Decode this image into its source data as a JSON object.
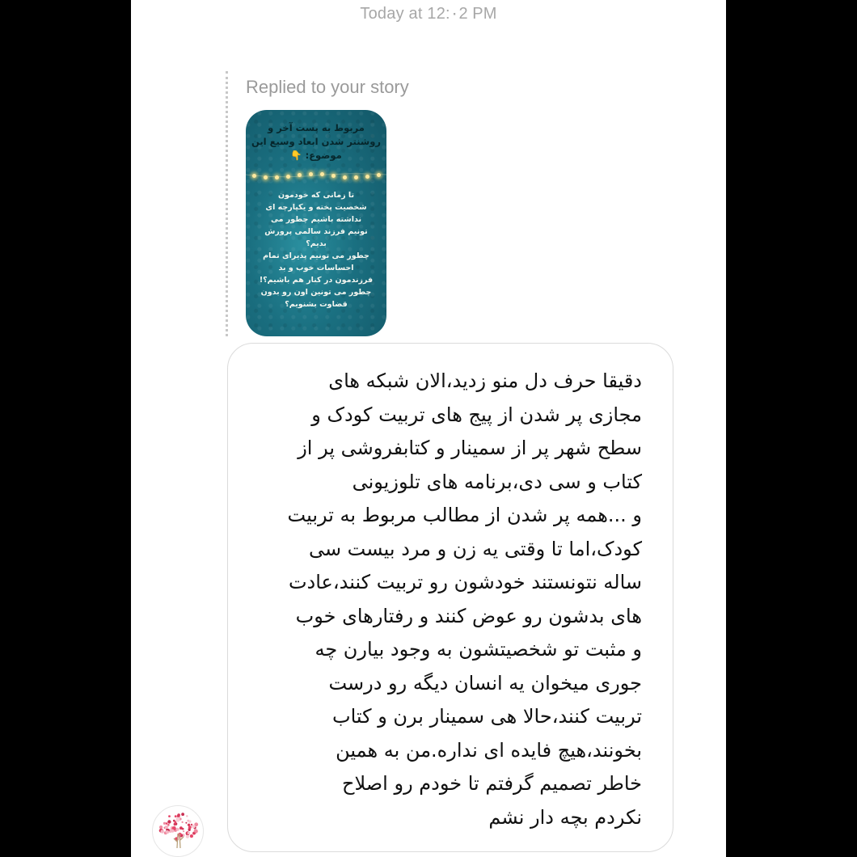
{
  "chat": {
    "timestamp": "Today at 12:۰2 PM",
    "reply_label": "Replied to your story",
    "story": {
      "title": "مربوط به پست آخر و روشنتر شدن ابعاد وسیع این موضوع: 👇",
      "body": "تا زمانی که خودمون\nشخصیت پخته و یکپارچه ای\nنداشته باشیم چطور می\nتونیم فرزند سالمی پرورش\nبدیم؟\nچطور می تونیم پذیرای تمام\nاحساسات خوب و بد\nفرزندمون در کنار هم باشیم؟!\nچطور می تونین اون رو بدون\nقضاوت بشنویم؟"
    },
    "message": {
      "text": "دقیقا حرف دل منو زدید،الان شبکه های\nمجازی  پر شدن از پیج های تربیت کودک و\nسطح شهر پر از سمینار و کتابفروشی پر از\nکتاب و سی دی،برنامه های تلوزیونی\nو ...همه پر شدن از مطالب مربوط به تربیت\nکودک،اما تا وقتی یه زن و مرد بیست سی\nساله نتونستند خودشون رو تربیت کنند،عادت\nهای بدشون رو عوض کنند و رفتارهای خوب\nو مثبت تو شخصیتشون به وجود بیارن چه\nجوری میخوان یه انسان دیگه رو درست\nتربیت کنند،حالا هی سمینار برن و کتاب\nبخونند،هیچ فایده ای نداره.من به همین\nخاطر تصمیم گرفتم تا خودم رو اصلاح\nنکردم بچه دار نشم"
    },
    "avatar_icon": "tree-avatar-icon",
    "colors": {
      "timestamp": "#a7a7a7",
      "reply_label": "#9a9a9a",
      "bubble_border": "#dbdbdb",
      "story_bg": "#1a6f80"
    }
  }
}
